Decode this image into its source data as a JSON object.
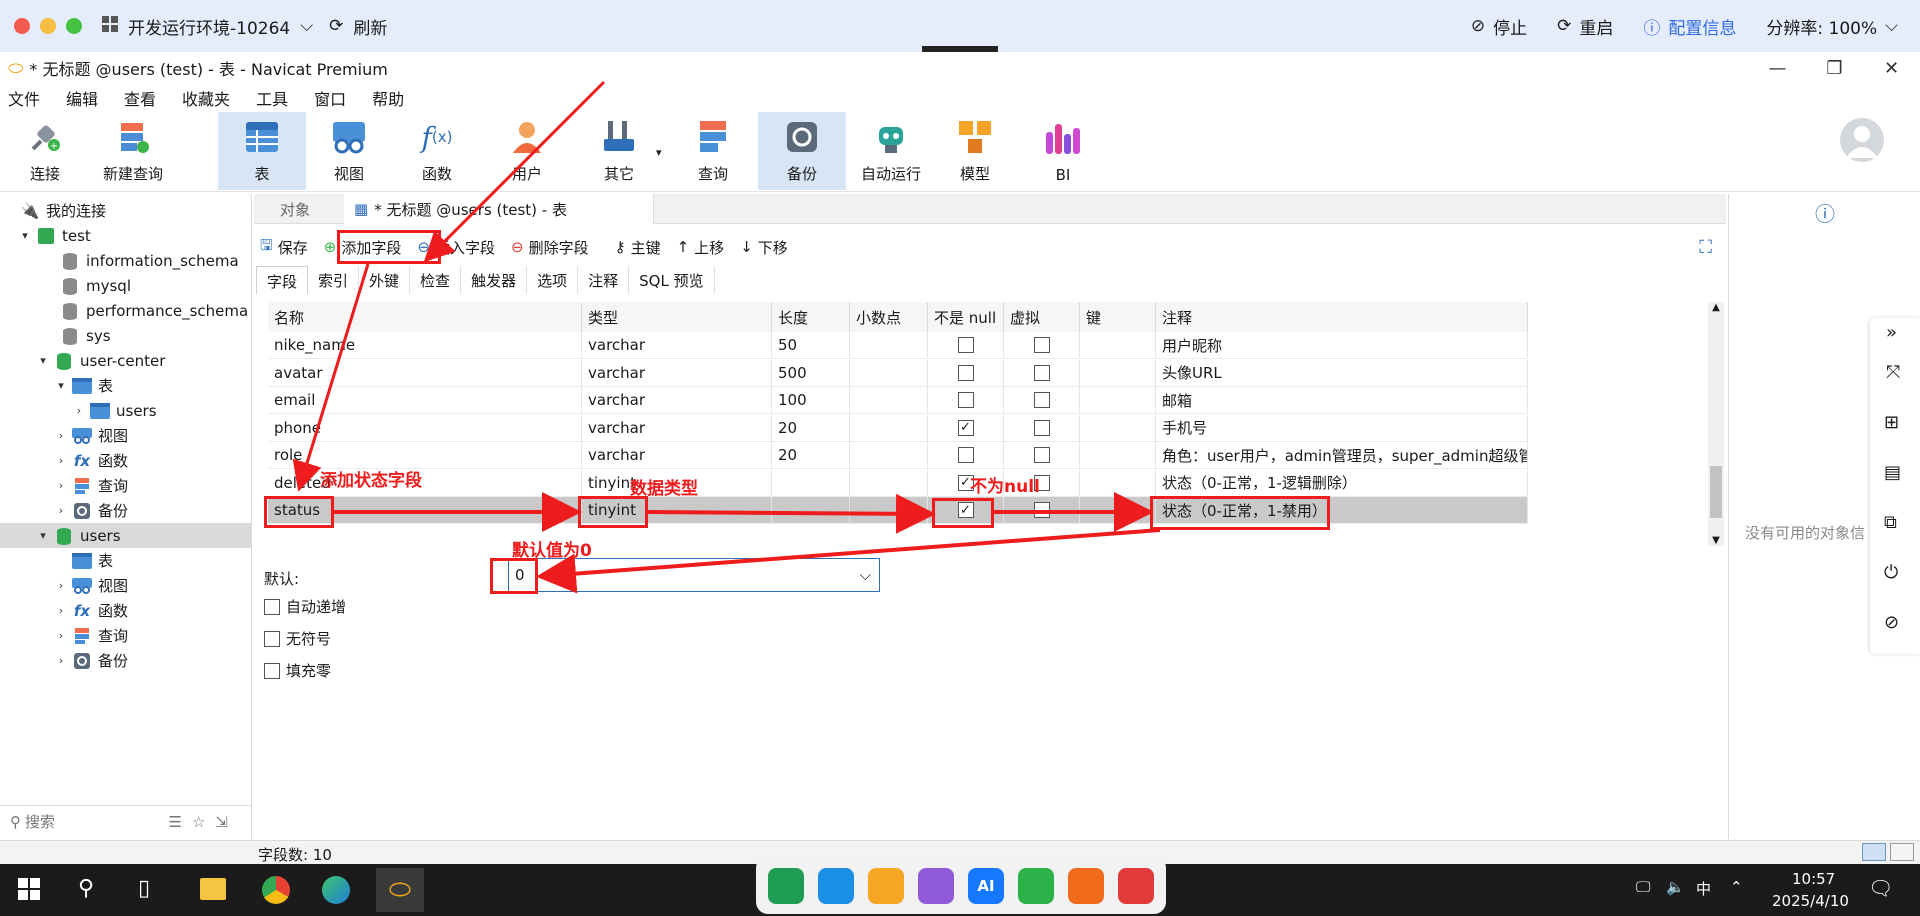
{
  "banner": {
    "env_title": "开发运行环境-10264",
    "refresh": "刷新",
    "stop": "停止",
    "restart": "重启",
    "config_info": "配置信息",
    "resolution": "分辨率: 100%"
  },
  "window": {
    "title": "* 无标题 @users (test) - 表 - Navicat Premium"
  },
  "menu": [
    "文件",
    "编辑",
    "查看",
    "收藏夹",
    "工具",
    "窗口",
    "帮助"
  ],
  "toolbar": [
    {
      "label": "连接",
      "icon": "plug-icon"
    },
    {
      "label": "新建查询",
      "icon": "new-query-icon"
    },
    {
      "label": "表",
      "icon": "table-icon"
    },
    {
      "label": "视图",
      "icon": "view-icon"
    },
    {
      "label": "函数",
      "icon": "function-icon"
    },
    {
      "label": "用户",
      "icon": "user-icon"
    },
    {
      "label": "其它",
      "icon": "tools-icon"
    },
    {
      "label": "查询",
      "icon": "query-icon"
    },
    {
      "label": "备份",
      "icon": "backup-icon"
    },
    {
      "label": "自动运行",
      "icon": "robot-icon"
    },
    {
      "label": "模型",
      "icon": "model-icon"
    },
    {
      "label": "BI",
      "icon": "bi-icon"
    }
  ],
  "nav": {
    "root": "我的连接",
    "items": [
      {
        "label": "test"
      },
      {
        "label": "information_schema"
      },
      {
        "label": "mysql"
      },
      {
        "label": "performance_schema"
      },
      {
        "label": "sys"
      },
      {
        "label": "user-center"
      },
      {
        "label": "表"
      },
      {
        "label": "users"
      },
      {
        "label": "视图"
      },
      {
        "label": "函数"
      },
      {
        "label": "查询"
      },
      {
        "label": "备份"
      },
      {
        "label": "users"
      },
      {
        "label": "表"
      },
      {
        "label": "视图"
      },
      {
        "label": "函数"
      },
      {
        "label": "查询"
      },
      {
        "label": "备份"
      }
    ],
    "search_placeholder": "搜索"
  },
  "tabs": {
    "objects": "对象",
    "active": "* 无标题 @users (test) - 表"
  },
  "table_tools": {
    "save": "保存",
    "add_field": "添加字段",
    "insert_field": "插入字段",
    "delete_field": "删除字段",
    "primary_key": "主键",
    "move_up": "上移",
    "move_down": "下移"
  },
  "subtabs": [
    "字段",
    "索引",
    "外键",
    "检查",
    "触发器",
    "选项",
    "注释",
    "SQL 预览"
  ],
  "grid": {
    "headers": [
      "名称",
      "类型",
      "长度",
      "小数点",
      "不是 null",
      "虚拟",
      "键",
      "注释"
    ],
    "rows": [
      {
        "name": "nike_name",
        "type": "varchar",
        "length": "50",
        "decimal": "",
        "not_null": false,
        "virtual": false,
        "comment": "用户昵称"
      },
      {
        "name": "avatar",
        "type": "varchar",
        "length": "500",
        "decimal": "",
        "not_null": false,
        "virtual": false,
        "comment": "头像URL"
      },
      {
        "name": "email",
        "type": "varchar",
        "length": "100",
        "decimal": "",
        "not_null": false,
        "virtual": false,
        "comment": "邮箱"
      },
      {
        "name": "phone",
        "type": "varchar",
        "length": "20",
        "decimal": "",
        "not_null": true,
        "virtual": false,
        "comment": "手机号"
      },
      {
        "name": "role",
        "type": "varchar",
        "length": "20",
        "decimal": "",
        "not_null": false,
        "virtual": false,
        "comment": "角色：user用户，admin管理员，super_admin超级管"
      },
      {
        "name": "deleted",
        "type": "tinyint",
        "length": "",
        "decimal": "",
        "not_null": true,
        "virtual": false,
        "comment": "状态（0-正常，1-逻辑删除）"
      },
      {
        "name": "status",
        "type": "tinyint",
        "length": "",
        "decimal": "",
        "not_null": true,
        "virtual": false,
        "comment": "状态（0-正常，1-禁用）"
      }
    ]
  },
  "props": {
    "default_label": "默认:",
    "default_value": "0",
    "auto_increment": "自动递增",
    "unsigned": "无符号",
    "zerofill": "填充零"
  },
  "right_panel": {
    "empty_text": "没有可用的对象信"
  },
  "status": {
    "field_count": "字段数: 10"
  },
  "taskbar": {
    "time": "10:57",
    "date": "2025/4/10",
    "ime": "中"
  },
  "annotations": {
    "add_status_field": "添加状态字段",
    "data_type": "数据类型",
    "not_null": "不为null",
    "default_zero": "默认值为0"
  }
}
